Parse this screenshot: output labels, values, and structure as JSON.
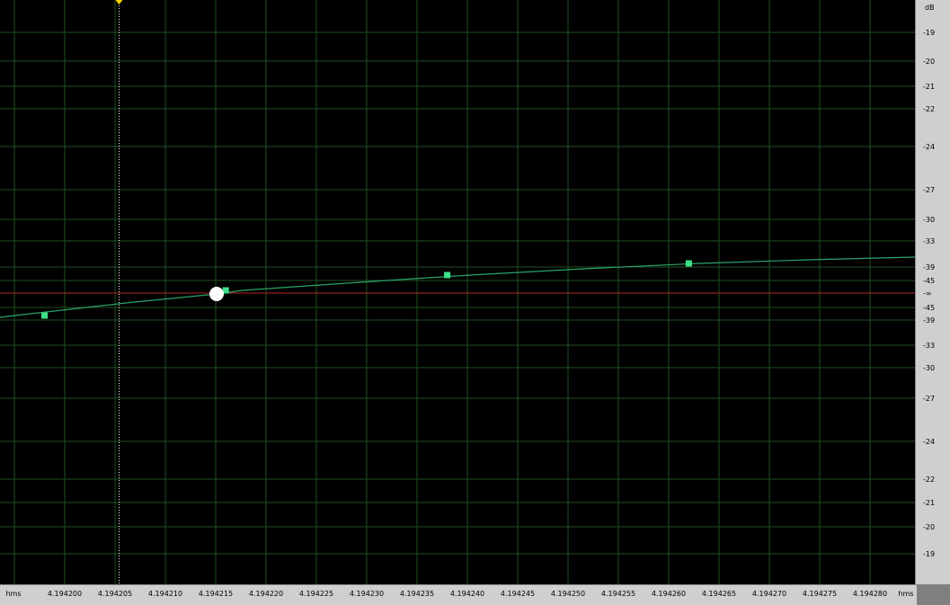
{
  "ruler": {
    "db_unit": "dB",
    "db_labels": [
      "-19",
      "-20",
      "-21",
      "-22",
      "-24",
      "-27",
      "-30",
      "-33",
      "-39",
      "-45",
      "-∞",
      "-45",
      "-39",
      "-33",
      "-30",
      "-27",
      "-24",
      "-22",
      "-21",
      "-20",
      "-19"
    ]
  },
  "time_axis": {
    "unit_left": "hms",
    "unit_right": "hms",
    "labels": [
      "4.194200",
      "4.194205",
      "4.194210",
      "4.194215",
      "4.194220",
      "4.194225",
      "4.194230",
      "4.194235",
      "4.194240",
      "4.194245",
      "4.194250",
      "4.194255",
      "4.194260",
      "4.194265",
      "4.194270",
      "4.194275",
      "4.194280"
    ]
  },
  "colors": {
    "grid": "#1f4f1f",
    "envelope": "#2aa46b",
    "node": "#3ee08a",
    "center_line": "#b22222",
    "cursor": "#ffffff",
    "marker": "#ffd400"
  },
  "chart_data": {
    "type": "line",
    "x_unit": "hms",
    "y_unit": "dB",
    "nodes_hms": [
      4.194198,
      4.194216,
      4.194238,
      4.194262
    ],
    "cursor_hms": 4.1942054
  }
}
